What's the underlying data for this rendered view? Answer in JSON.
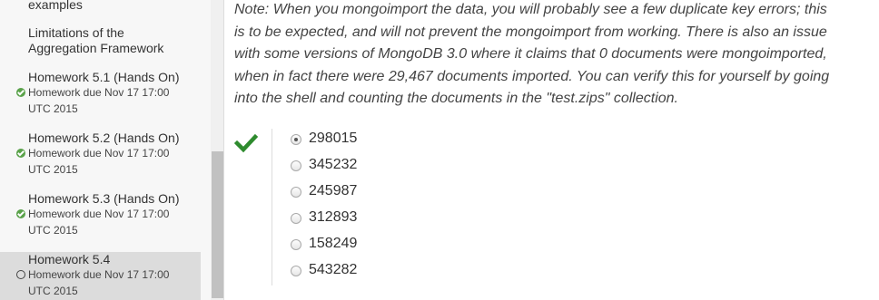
{
  "sidebar": {
    "items": [
      {
        "title": "examples"
      },
      {
        "title_line1": "Limitations of the",
        "title_line2": "Aggregation Framework"
      },
      {
        "title": "Homework 5.1 (Hands On)",
        "due_line1": "Homework due Nov 17 17:00",
        "due_line2": "UTC 2015",
        "status": "done"
      },
      {
        "title": "Homework 5.2 (Hands On)",
        "due_line1": "Homework due Nov 17 17:00",
        "due_line2": "UTC 2015",
        "status": "done"
      },
      {
        "title": "Homework 5.3 (Hands On)",
        "due_line1": "Homework due Nov 17 17:00",
        "due_line2": "UTC 2015",
        "status": "done"
      },
      {
        "title": "Homework 5.4",
        "due_line1": "Homework due Nov 17 17:00",
        "due_line2": "UTC 2015",
        "status": "open"
      }
    ]
  },
  "main": {
    "note_lines": [
      "Note: When you mongoimport the data, you will probably see a few duplicate key errors; this",
      "is to be expected, and will not prevent the mongoimport from working. There is also an issue",
      "with some versions of MongoDB 3.0 where it claims that 0 documents were mongoimported,",
      "when in fact there were 29,467 documents imported. You can verify this for yourself by going",
      "into the shell and counting the documents in the \"test.zips\" collection."
    ],
    "options": [
      "298015",
      "345232",
      "245987",
      "312893",
      "158249",
      "543282"
    ],
    "selected_option": "298015",
    "result": "correct",
    "colors": {
      "correct": "#2e8b2e",
      "status_done": "#5aa24a"
    }
  }
}
